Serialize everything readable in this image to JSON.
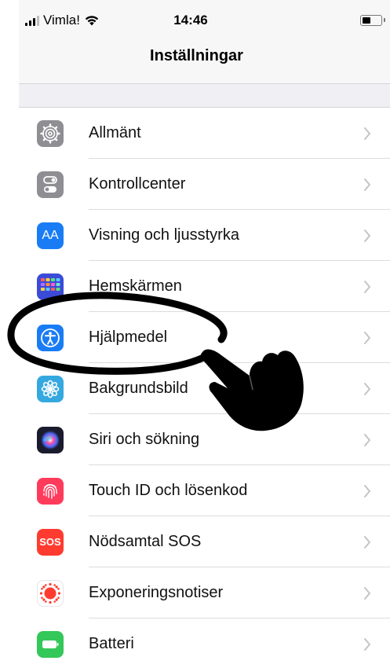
{
  "status_bar": {
    "carrier": "Vimla!",
    "time": "14:46",
    "battery_level": 0.45
  },
  "nav": {
    "title": "Inställningar"
  },
  "settings": [
    {
      "label": "Allmänt",
      "icon": "gear-icon",
      "color": "#8e8e93"
    },
    {
      "label": "Kontrollcenter",
      "icon": "switches-icon",
      "color": "#8e8e93"
    },
    {
      "label": "Visning och ljusstyrka",
      "icon": "text-size-icon",
      "icon_text": "AA",
      "color": "#1a7cf5"
    },
    {
      "label": "Hemskärmen",
      "icon": "app-grid-icon",
      "color": "#3b4bd8"
    },
    {
      "label": "Hjälpmedel",
      "icon": "accessibility-icon",
      "color": "#1a7cf5"
    },
    {
      "label": "Bakgrundsbild",
      "icon": "flower-icon",
      "color": "#36a8e0"
    },
    {
      "label": "Siri och sökning",
      "icon": "siri-icon",
      "color": "#1b1b2e"
    },
    {
      "label": "Touch ID och lösenkod",
      "icon": "fingerprint-icon",
      "color": "#ff3b5c"
    },
    {
      "label": "Nödsamtal SOS",
      "icon": "sos-icon",
      "icon_text": "SOS",
      "color": "#ff3b30"
    },
    {
      "label": "Exponeringsnotiser",
      "icon": "exposure-icon",
      "color": "#ffffff"
    },
    {
      "label": "Batteri",
      "icon": "battery-icon",
      "color": "#34c759"
    }
  ],
  "annotation": {
    "circled_item": "Hjälpmedel",
    "pointer": "pointing-hand-icon"
  }
}
